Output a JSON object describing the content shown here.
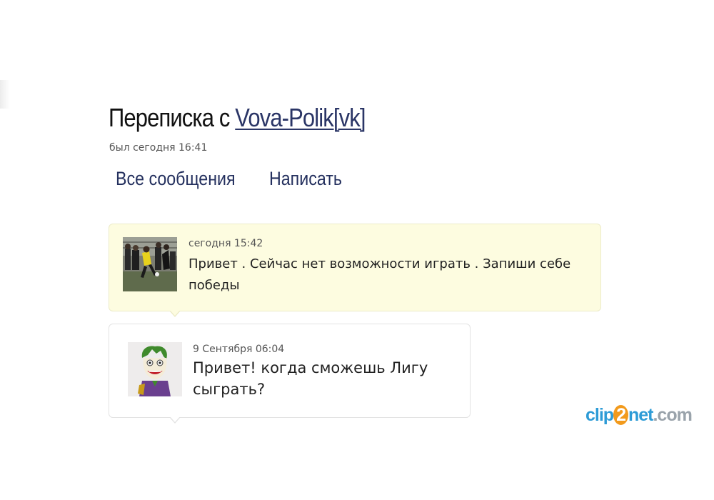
{
  "header": {
    "title_prefix": "Переписка с ",
    "contact_name": "Vova-Polik[vk]",
    "last_seen": "был сегодня 16:41"
  },
  "nav": {
    "all_messages": "Все сообщения",
    "write": "Написать"
  },
  "messages": [
    {
      "time": "сегодня 15:42",
      "text": "Привет . Сейчас нет возможности играть . Запиши себе победы",
      "background": "#fdfce0",
      "avatar_icon": "football-player-photo"
    },
    {
      "time": "9 Сентября 06:04",
      "text": "Привет! когда сможешь Лигу сыграть?",
      "background": "#ffffff",
      "avatar_icon": "joker-cartoon-avatar"
    }
  ],
  "watermark": {
    "part1": "clip",
    "part2": "2",
    "part3": "net",
    "part4": ".com",
    "blue": "#2d9bd6",
    "orange": "#f29a1c",
    "grey": "#9aa3ab"
  },
  "colors": {
    "link": "#2a3566",
    "nav": "#24305e",
    "incoming_bg": "#fdfce0",
    "incoming_border": "#ecebc8"
  }
}
